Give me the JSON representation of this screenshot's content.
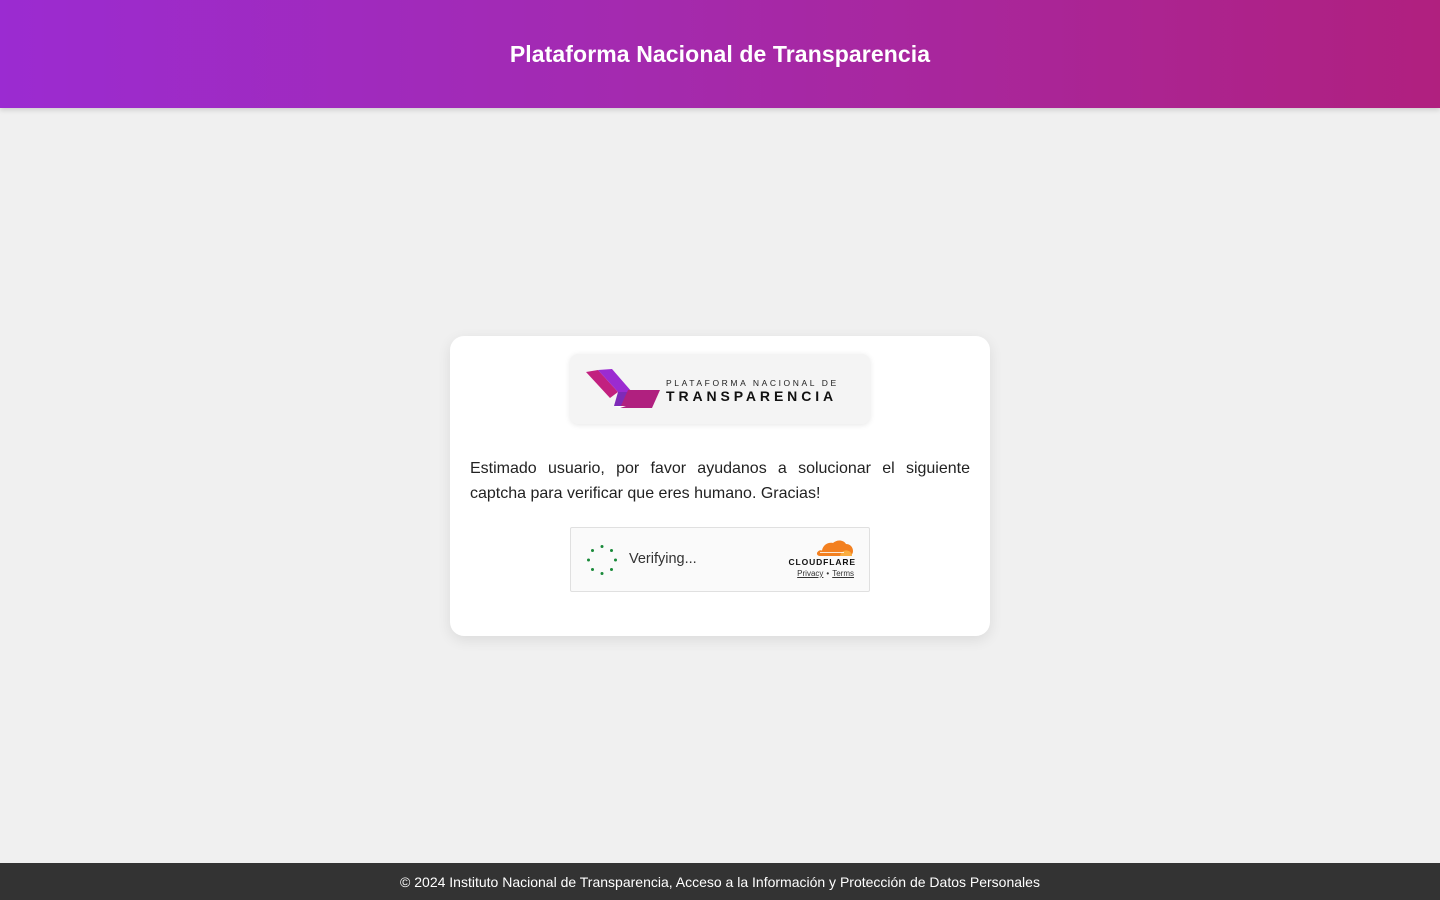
{
  "header": {
    "title": "Plataforma Nacional de Transparencia"
  },
  "logo": {
    "line1": "PLATAFORMA NACIONAL DE",
    "line2": "TRANSPARENCIA",
    "colors": {
      "magenta": "#c2207f",
      "purple": "#9b2bd1"
    }
  },
  "message": "Estimado usuario, por favor ayudanos a solucionar el siguiente captcha para verificar que eres humano. Gracias!",
  "captcha": {
    "status": "Verifying...",
    "spinner_icon": "loading-spinner-icon",
    "brand": "CLOUDFLARE",
    "brand_icon": "cloudflare-cloud-icon",
    "privacy_label": "Privacy",
    "separator": "•",
    "terms_label": "Terms",
    "colors": {
      "spinner": "#1a8a3a",
      "cloud": "#f38020"
    }
  },
  "footer": {
    "text": "© 2024 Instituto Nacional de Transparencia, Acceso a la Información y Protección de Datos Personales"
  },
  "colors": {
    "header_start": "#9b2bd1",
    "header_end": "#b0207f",
    "background": "#f0f0f0",
    "footer_bg": "#333333"
  }
}
